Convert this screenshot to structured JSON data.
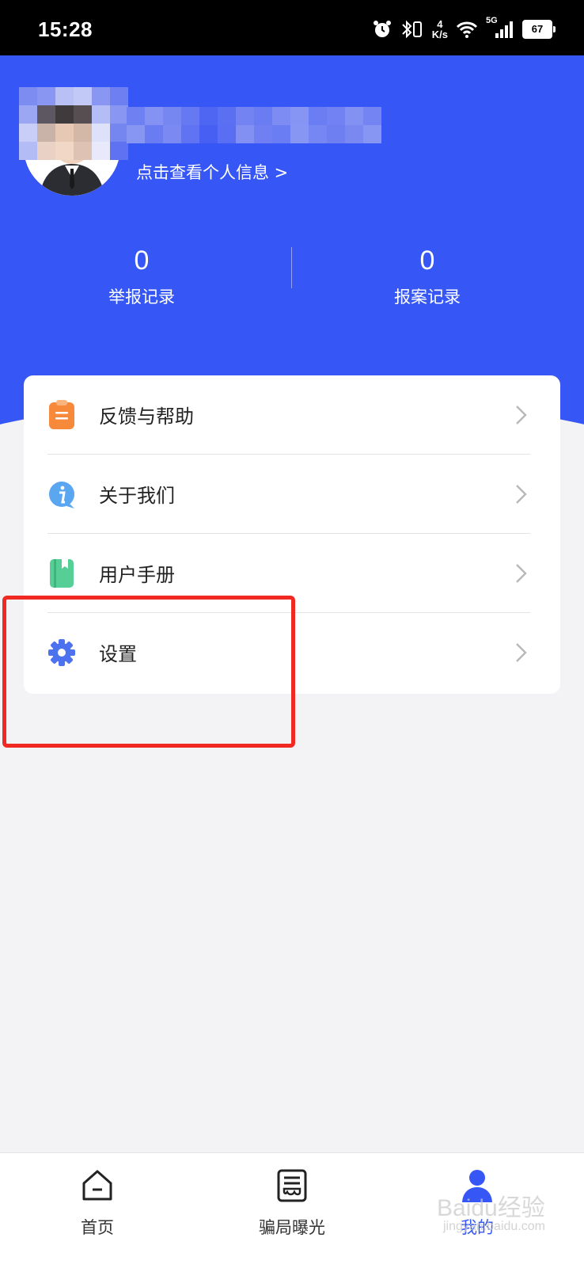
{
  "status_bar": {
    "time": "15:28",
    "speed_top": "4",
    "speed_unit": "K/s",
    "network": "5G",
    "battery": "67"
  },
  "profile": {
    "view_info_link": "点击查看个人信息 >"
  },
  "stats": [
    {
      "value": "0",
      "label": "举报记录"
    },
    {
      "value": "0",
      "label": "报案记录"
    }
  ],
  "menu": [
    {
      "label": "反馈与帮助",
      "icon": "clipboard-icon",
      "color": "#f7893b"
    },
    {
      "label": "关于我们",
      "icon": "info-bubble-icon",
      "color": "#5aa6f0"
    },
    {
      "label": "用户手册",
      "icon": "book-icon",
      "color": "#55cf96"
    },
    {
      "label": "设置",
      "icon": "gear-icon",
      "color": "#4c72f0"
    }
  ],
  "tabs": [
    {
      "label": "首页",
      "icon": "home-icon"
    },
    {
      "label": "骗局曝光",
      "icon": "exposure-icon"
    },
    {
      "label": "我的",
      "icon": "user-icon",
      "active": true
    }
  ],
  "colors": {
    "primary": "#3657f5",
    "highlight": "#f02a22",
    "background": "#f3f3f5"
  },
  "watermark": {
    "text": "Baidu经验",
    "sub": "jingyan.baidu.com"
  }
}
